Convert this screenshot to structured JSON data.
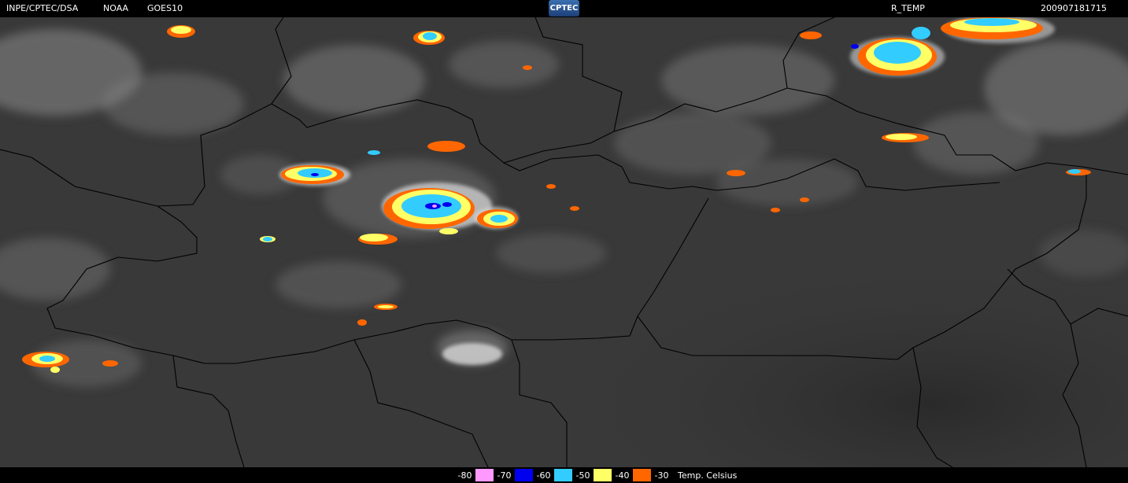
{
  "header": {
    "org": "INPE/CPTEC/DSA",
    "agency": "NOAA",
    "satellite": "GOES10",
    "logo_text": "CPTEC",
    "product": "R_TEMP",
    "timestamp": "200907181715"
  },
  "legend": {
    "title": "Temp. Celsius",
    "items": [
      {
        "label": "-80",
        "color": "#ff99ff"
      },
      {
        "label": "-70",
        "color": "#0000ee"
      },
      {
        "label": "-60",
        "color": "#33ccff"
      },
      {
        "label": "-50",
        "color": "#ffff66"
      },
      {
        "label": "-40",
        "color": "#ff6600"
      },
      {
        "label": "-30",
        "color": ""
      }
    ]
  },
  "map": {
    "type": "satellite infrared enhanced image",
    "colors": {
      "background": "#3a3a3a",
      "borders": "#000000"
    }
  }
}
